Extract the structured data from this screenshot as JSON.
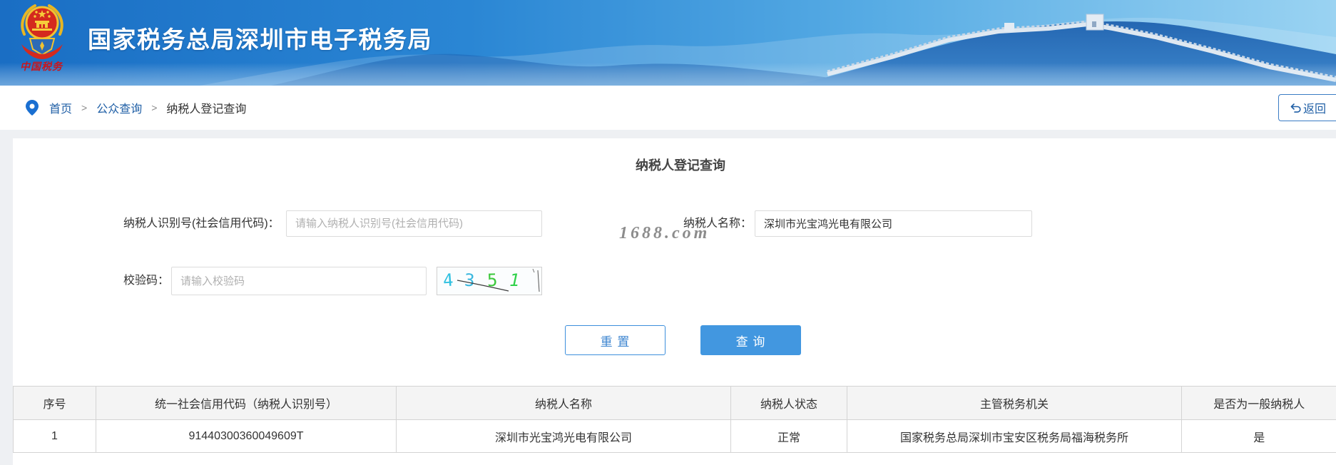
{
  "header": {
    "site_title": "国家税务总局深圳市电子税务局",
    "logo_text": "中国税务"
  },
  "breadcrumb": {
    "home": "首页",
    "public_query": "公众查询",
    "current": "纳税人登记查询",
    "separator": ">"
  },
  "return_button": {
    "label": "返回"
  },
  "form": {
    "title": "纳税人登记查询",
    "taxpayer_id": {
      "label": "纳税人识别号(社会信用代码)：",
      "placeholder": "请输入纳税人识别号(社会信用代码)"
    },
    "taxpayer_name": {
      "label": "纳税人名称：",
      "value": "深圳市光宝鸿光电有限公司"
    },
    "captcha": {
      "label": "校验码：",
      "placeholder": "请输入校验码",
      "code": [
        "4",
        "3",
        "5",
        "1"
      ]
    },
    "reset_label": "重 置",
    "query_label": "查 询"
  },
  "results_table": {
    "columns": [
      "序号",
      "统一社会信用代码（纳税人识别号）",
      "纳税人名称",
      "纳税人状态",
      "主管税务机关",
      "是否为一般纳税人"
    ],
    "rows": [
      [
        "1",
        "91440300360049609T",
        "深圳市光宝鸿光电有限公司",
        "正常",
        "国家税务总局深圳市宝安区税务局福海税务所",
        "是"
      ]
    ]
  },
  "watermark": "1688.com",
  "icons": {
    "logo": "tax-emblem-icon",
    "breadcrumb": "location-pin-icon",
    "return": "back-arrow-icon"
  },
  "colors": {
    "primary_button": "#4297e0",
    "link": "#1f5fa6",
    "banner_blue": "#2a82d2",
    "captcha_cyan": "#2fc0e0",
    "captcha_green": "#3cc83c"
  }
}
